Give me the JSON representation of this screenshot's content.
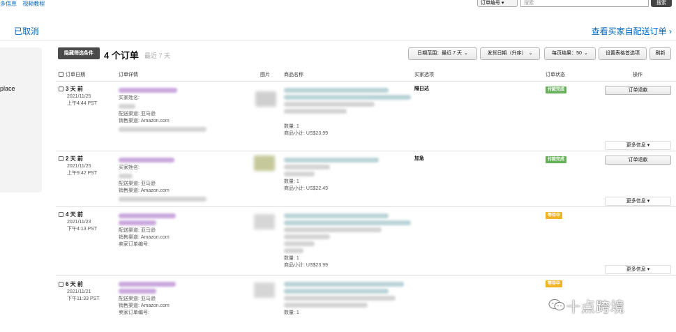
{
  "topbar": {
    "link1": "多信息",
    "link2": "视频教程",
    "search_type": "订单编号",
    "search_placeholder": "搜索",
    "search_button": "搜索"
  },
  "tabs": {
    "cancelled": "已取消",
    "view_link": "查看买家自配送订单 ›"
  },
  "sidebar": {
    "label": "place"
  },
  "toolbar": {
    "filter_button": "隐藏筛选条件",
    "order_count": "4 个订单",
    "order_range": "最近 7 天",
    "date_range": "日期范围：最近 7 天",
    "sort": "发货日期（升序）",
    "per_page": "每页结果：50",
    "table_settings": "设置表格首选项",
    "refresh": "刷新"
  },
  "columns": {
    "order_date": "订单日期",
    "order_details": "订单详情",
    "image": "图片",
    "product_name": "商品名称",
    "buyer_options": "买家选项",
    "order_status": "订单状态",
    "action": "操作"
  },
  "orders": [
    {
      "ago": "3 天 前",
      "date": "2021/11/25",
      "time": "上午4:44 PST",
      "buyer_label": "买家姓名:",
      "ship_channel": "配送渠道: 亚马逊",
      "sales_channel": "销售渠道: Amazon.com",
      "qty": "数量: 1",
      "subtotal": "商品小计: US$23.99",
      "buyer_option": "隔日达",
      "status": "付款完成",
      "action": "订单退款",
      "more": "更多信息 ▾"
    },
    {
      "ago": "2 天 前",
      "date": "2021/11/25",
      "time": "上午9:42 PST",
      "buyer_label": "买家姓名:",
      "ship_channel": "配送渠道: 亚马逊",
      "sales_channel": "销售渠道: Amazon.com",
      "qty": "数量: 1",
      "subtotal": "商品小计: US$22.49",
      "buyer_option": "加急",
      "status": "付款完成",
      "action": "订单退款",
      "more": "更多信息 ▾"
    },
    {
      "ago": "4 天 前",
      "date": "2021/11/23",
      "time": "下午4:13 PST",
      "ship_channel": "配送渠道: 亚马逊",
      "sales_channel": "销售渠道: Amazon.com",
      "seller_order": "卖家订单编号:",
      "qty": "数量: 1",
      "subtotal": "商品小计: US$23.99",
      "status": "等待中",
      "more": "更多信息 ▾"
    },
    {
      "ago": "6 天 前",
      "date": "2021/11/21",
      "time": "下午11:33 PST",
      "ship_channel": "配送渠道: 亚马逊",
      "sales_channel": "销售渠道: Amazon.com",
      "seller_order": "卖家订单编号:",
      "qty": "数量: 1",
      "status": "等待中"
    }
  ],
  "watermark": "十点跨境",
  "colors": {
    "link": "#0066c0",
    "paid": "#67b05a",
    "pending": "#f0b323"
  }
}
